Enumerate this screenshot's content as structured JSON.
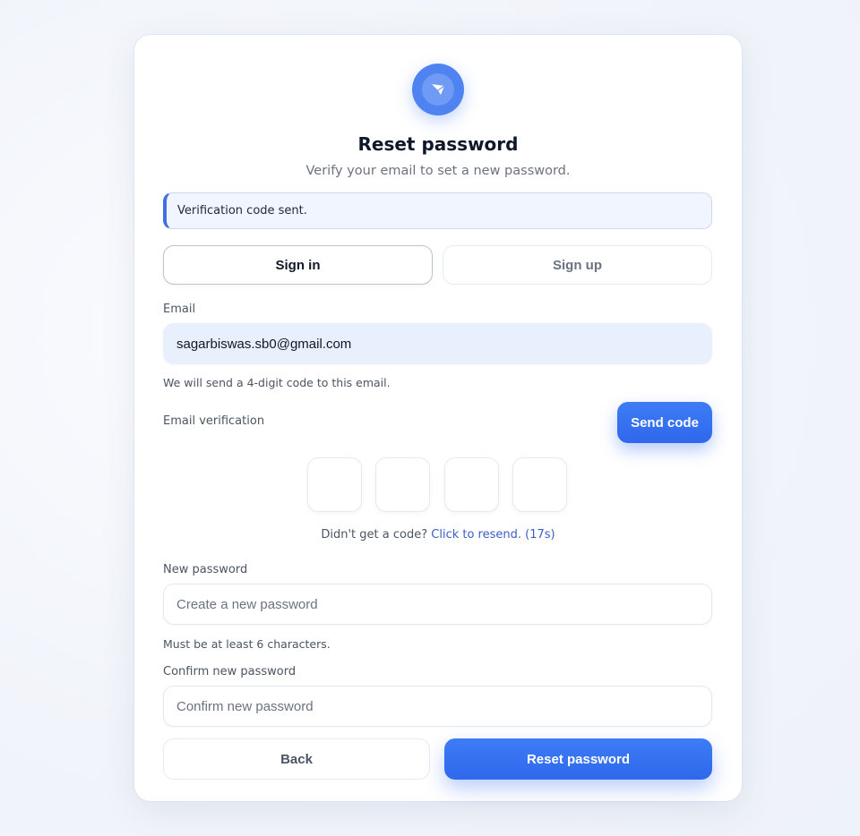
{
  "header": {
    "logo_icon": "paper-plane-icon",
    "title": "Reset password",
    "subtitle": "Verify your email to set a new password."
  },
  "alert": {
    "message": "Verification code sent."
  },
  "tabs": [
    {
      "label": "Sign in",
      "active": true
    },
    {
      "label": "Sign up",
      "active": false
    }
  ],
  "email": {
    "label": "Email",
    "value": "sagarbiswas.sb0@gmail.com",
    "hint": "We will send a 4-digit code to this email."
  },
  "verification": {
    "label": "Email verification",
    "send_button": "Send code",
    "digits": [
      "",
      "",
      "",
      ""
    ],
    "resend_prefix": "Didn't get a code?",
    "resend_link": "Click to resend. (17s)"
  },
  "new_password": {
    "label": "New password",
    "placeholder": "Create a new password",
    "hint": "Must be at least 6 characters."
  },
  "confirm_password": {
    "label": "Confirm new password",
    "placeholder": "Confirm new password"
  },
  "actions": {
    "back": "Back",
    "reset": "Reset password"
  },
  "colors": {
    "accent": "#2f68ec",
    "logo": "#4f83f1",
    "page_background": "#f3f6fb"
  }
}
